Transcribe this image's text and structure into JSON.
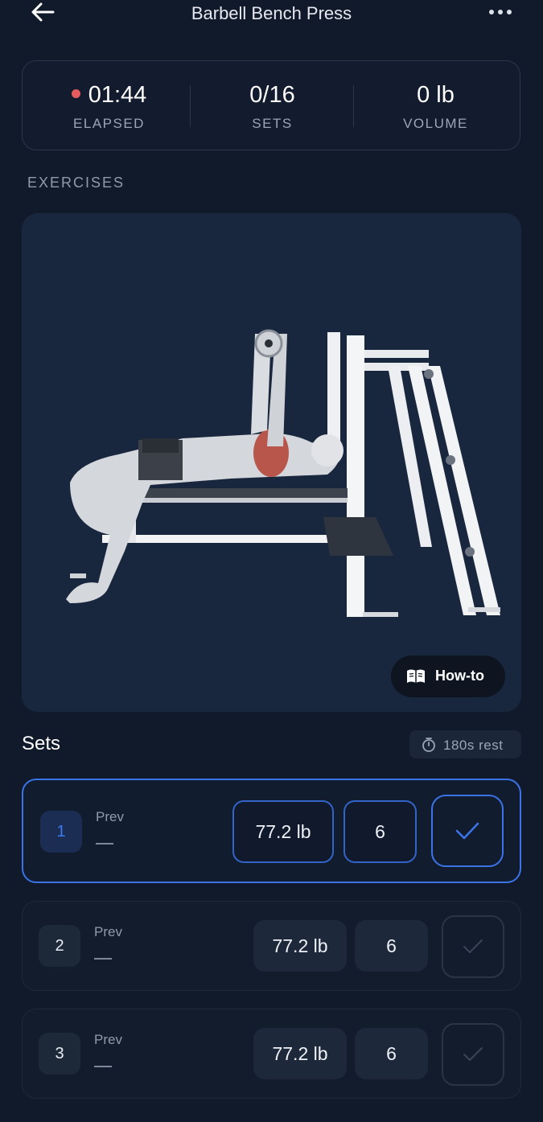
{
  "header": {
    "title": "Barbell Bench Press",
    "back_icon": "arrow-left-icon",
    "more_icon": "more-dots-icon"
  },
  "stats": {
    "elapsed": {
      "value": "01:44",
      "label": "ELAPSED",
      "indicator_color": "#e65c5c"
    },
    "sets": {
      "value": "0/16",
      "label": "SETS"
    },
    "volume": {
      "value": "0 lb",
      "label": "VOLUME"
    }
  },
  "exercises_label": "EXERCISES",
  "exercise": {
    "image": "barbell-bench-press-illustration",
    "howto_label": "How-to"
  },
  "sets_section": {
    "title": "Sets",
    "rest_label": "180s rest"
  },
  "sets": [
    {
      "number": "1",
      "prev_label": "Prev",
      "prev_value": "—",
      "weight": "77.2 lb",
      "reps": "6",
      "active": true
    },
    {
      "number": "2",
      "prev_label": "Prev",
      "prev_value": "—",
      "weight": "77.2 lb",
      "reps": "6",
      "active": false
    },
    {
      "number": "3",
      "prev_label": "Prev",
      "prev_value": "—",
      "weight": "77.2 lb",
      "reps": "6",
      "active": false
    }
  ],
  "colors": {
    "background": "#111a2b",
    "accent": "#3b74e8",
    "card": "#19273e"
  }
}
